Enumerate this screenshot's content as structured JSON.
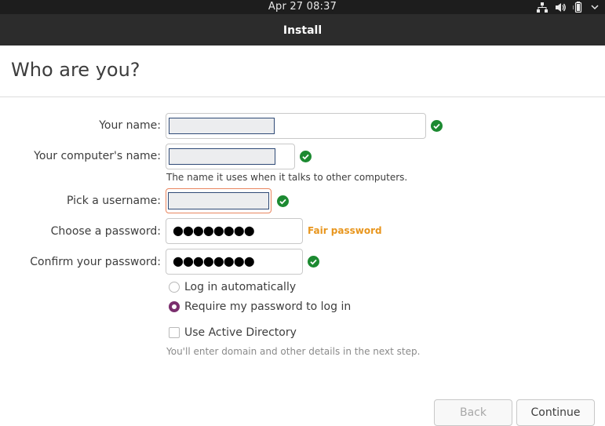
{
  "system_bar": {
    "clock": "Apr 27  08:37",
    "icons": [
      "network-wired-icon",
      "volume-icon",
      "battery-icon",
      "chevron-down-icon"
    ]
  },
  "window": {
    "title": "Install"
  },
  "page": {
    "heading": "Who are you?"
  },
  "form": {
    "name_label": "Your name:",
    "computer_label": "Your computer's name:",
    "computer_hint": "The name it uses when it talks to other computers.",
    "username_label": "Pick a username:",
    "password_label": "Choose a password:",
    "password_value": "●●●●●●●●",
    "password_strength": "Fair password",
    "confirm_label": "Confirm your password:",
    "confirm_value": "●●●●●●●●",
    "login_auto_label": "Log in automatically",
    "require_password_label": "Require my password to log in",
    "active_directory_label": "Use Active Directory",
    "active_directory_hint": "You'll enter domain and other details in the next step."
  },
  "state": {
    "login_option_selected": "require_password",
    "active_directory_checked": false
  },
  "buttons": {
    "back": "Back",
    "continue": "Continue"
  },
  "colors": {
    "accent": "#7b2f6e",
    "valid": "#1c8a31",
    "strength_fair": "#e8961e",
    "focus": "#e9855f"
  }
}
